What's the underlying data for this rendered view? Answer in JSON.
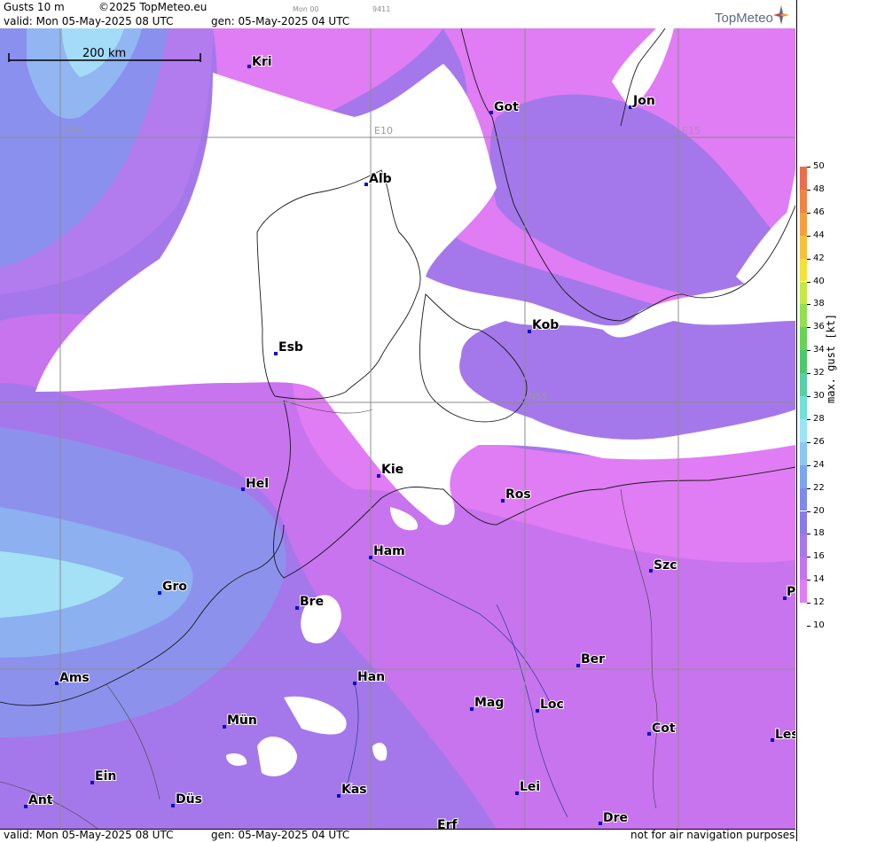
{
  "header": {
    "product": "Gusts 10 m",
    "copyright": "©2025 TopMeteo.eu",
    "run_code": "Mon 00",
    "code2": "9411",
    "valid": "valid:  Mon  05-May-2025  08 UTC",
    "gen": "gen: 05-May-2025 04 UTC"
  },
  "footer": {
    "valid": "valid:  Mon  05-May-2025  08 UTC",
    "gen": "gen: 05-May-2025 04 UTC",
    "notice": "not for air navigation purposes"
  },
  "brand": {
    "logo": "TopMeteo",
    "logo_icon": "compass-star-icon"
  },
  "scale_bar": "200 km",
  "grid_labels": {
    "e05": "E05",
    "e10": "E10",
    "e15": "E15",
    "n55": "N55"
  },
  "legend": {
    "title": "max. gust [kt]",
    "levels": [
      {
        "value": "50",
        "color": "#e8604a"
      },
      {
        "value": "48",
        "color": "#ec6e48"
      },
      {
        "value": "46",
        "color": "#f08446"
      },
      {
        "value": "44",
        "color": "#f4a040"
      },
      {
        "value": "42",
        "color": "#f6c23a"
      },
      {
        "value": "40",
        "color": "#f2e23a"
      },
      {
        "value": "38",
        "color": "#c4e846"
      },
      {
        "value": "36",
        "color": "#92e050"
      },
      {
        "value": "34",
        "color": "#66d456"
      },
      {
        "value": "32",
        "color": "#4cc86a"
      },
      {
        "value": "30",
        "color": "#56d0a4"
      },
      {
        "value": "28",
        "color": "#72e0d8"
      },
      {
        "value": "26",
        "color": "#9ae4f4"
      },
      {
        "value": "24",
        "color": "#8cc6f2"
      },
      {
        "value": "22",
        "color": "#7aa6ee"
      },
      {
        "value": "20",
        "color": "#7c8aec"
      },
      {
        "value": "18",
        "color": "#8a7ae8"
      },
      {
        "value": "16",
        "color": "#a876ea"
      },
      {
        "value": "14",
        "color": "#c474ee"
      },
      {
        "value": "12",
        "color": "#e27cf4"
      },
      {
        "value": "10",
        "color": "#ffffff"
      }
    ]
  },
  "cities": [
    {
      "name": "Kri"
    },
    {
      "name": "Got"
    },
    {
      "name": "Jon"
    },
    {
      "name": "Alb"
    },
    {
      "name": "Kob"
    },
    {
      "name": "Esb"
    },
    {
      "name": "Kie"
    },
    {
      "name": "Hel"
    },
    {
      "name": "Ros"
    },
    {
      "name": "Ham"
    },
    {
      "name": "Szc"
    },
    {
      "name": "Gro"
    },
    {
      "name": "Bre"
    },
    {
      "name": "P"
    },
    {
      "name": "Ber"
    },
    {
      "name": "Ams"
    },
    {
      "name": "Han"
    },
    {
      "name": "Mag"
    },
    {
      "name": "Loc"
    },
    {
      "name": "Mün"
    },
    {
      "name": "Cot"
    },
    {
      "name": "Les"
    },
    {
      "name": "Ein"
    },
    {
      "name": "Kas"
    },
    {
      "name": "Lei"
    },
    {
      "name": "Ant"
    },
    {
      "name": "Düs"
    },
    {
      "name": "Dre"
    },
    {
      "name": "Erf"
    }
  ]
}
